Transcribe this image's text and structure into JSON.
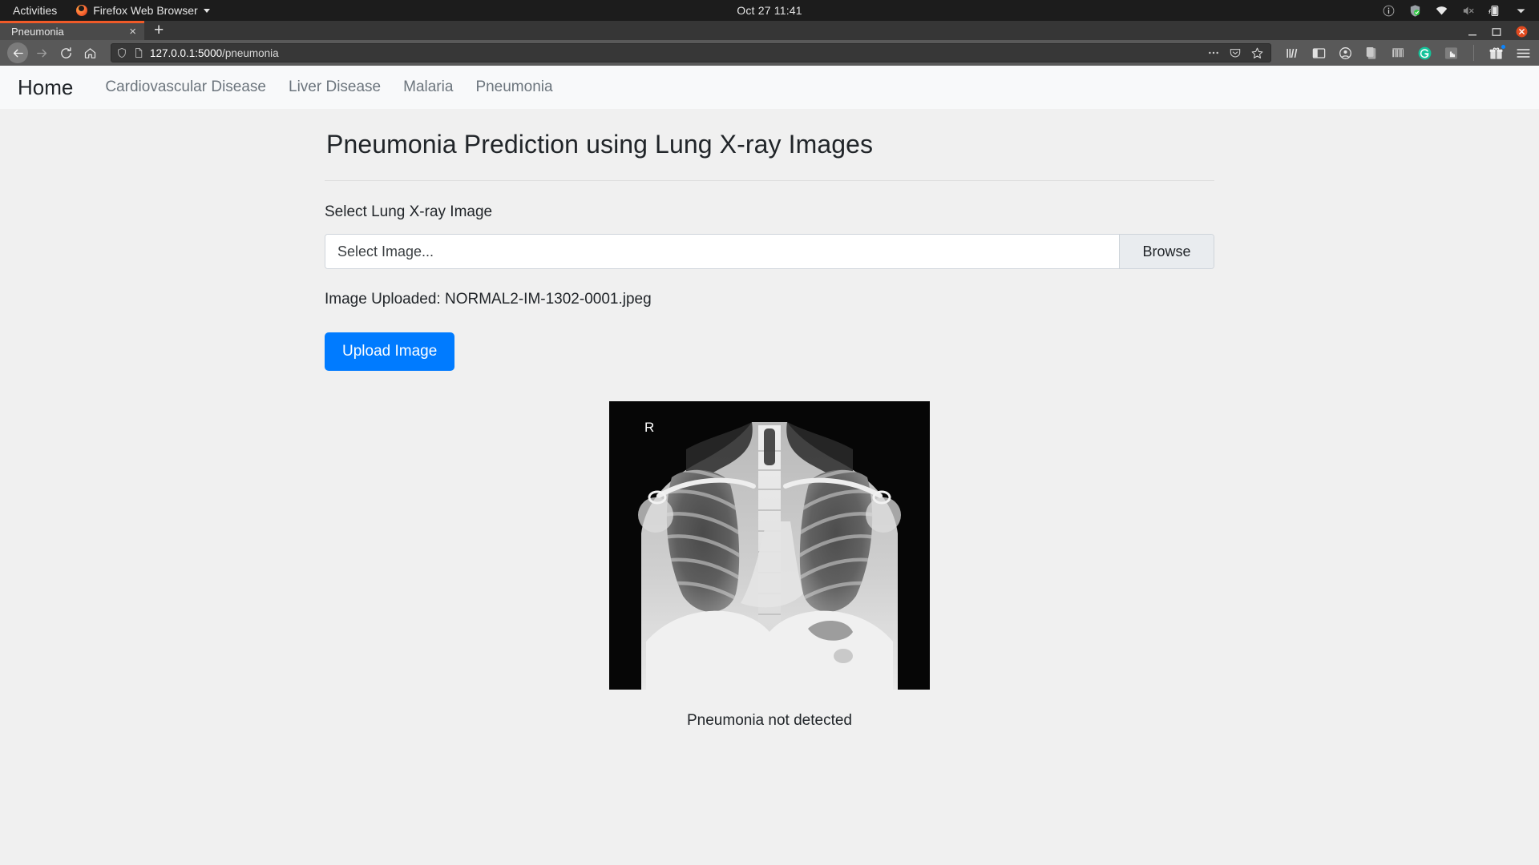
{
  "os_bar": {
    "activities": "Activities",
    "app_name": "Firefox Web Browser",
    "clock": "Oct 27  11:41",
    "tray_icons": [
      "info-icon",
      "shield-check-icon",
      "wifi-icon",
      "volume-muted-icon",
      "battery-charging-icon",
      "chevron-down-icon"
    ]
  },
  "browser": {
    "tab_title": "Pneumonia",
    "tab_close": "×",
    "new_tab": "+",
    "url_full": "127.0.0.1:5000/pneumonia",
    "url_host": "127.0.0.1:5000",
    "url_path": "/pneumonia",
    "nav_icons": [
      "back-icon",
      "forward-icon",
      "reload-icon",
      "home-icon"
    ],
    "urlbar_icons": [
      "shield-icon",
      "page-info-icon"
    ],
    "urlbar_right_icons": [
      "more-options-icon",
      "pocket-icon",
      "bookmark-star-icon"
    ],
    "toolbar_icons": [
      "library-icon",
      "sidebar-icon",
      "account-icon",
      "clipboard-icon",
      "barcode-icon",
      "grammarly-icon",
      "extension-hand-icon",
      "gift-icon",
      "hamburger-menu-icon"
    ],
    "window_controls": [
      "minimize",
      "maximize",
      "close"
    ]
  },
  "site_nav": {
    "brand": "Home",
    "links": [
      "Cardiovascular Disease",
      "Liver Disease",
      "Malaria",
      "Pneumonia"
    ]
  },
  "main": {
    "title": "Pneumonia Prediction using Lung X-ray Images",
    "field_label": "Select Lung X-ray Image",
    "file_placeholder": "Select Image...",
    "browse_label": "Browse",
    "uploaded_text": "Image Uploaded: NORMAL2-IM-1302-0001.jpeg",
    "upload_button": "Upload Image",
    "xray_marker": "R",
    "result": "Pneumonia not detected"
  },
  "colors": {
    "accent_blue": "#007bff",
    "brand_orange": "#f05a28",
    "nav_link": "#6c757d",
    "page_bg": "#f0f0f0",
    "navbar_bg": "#f8f9fa"
  }
}
